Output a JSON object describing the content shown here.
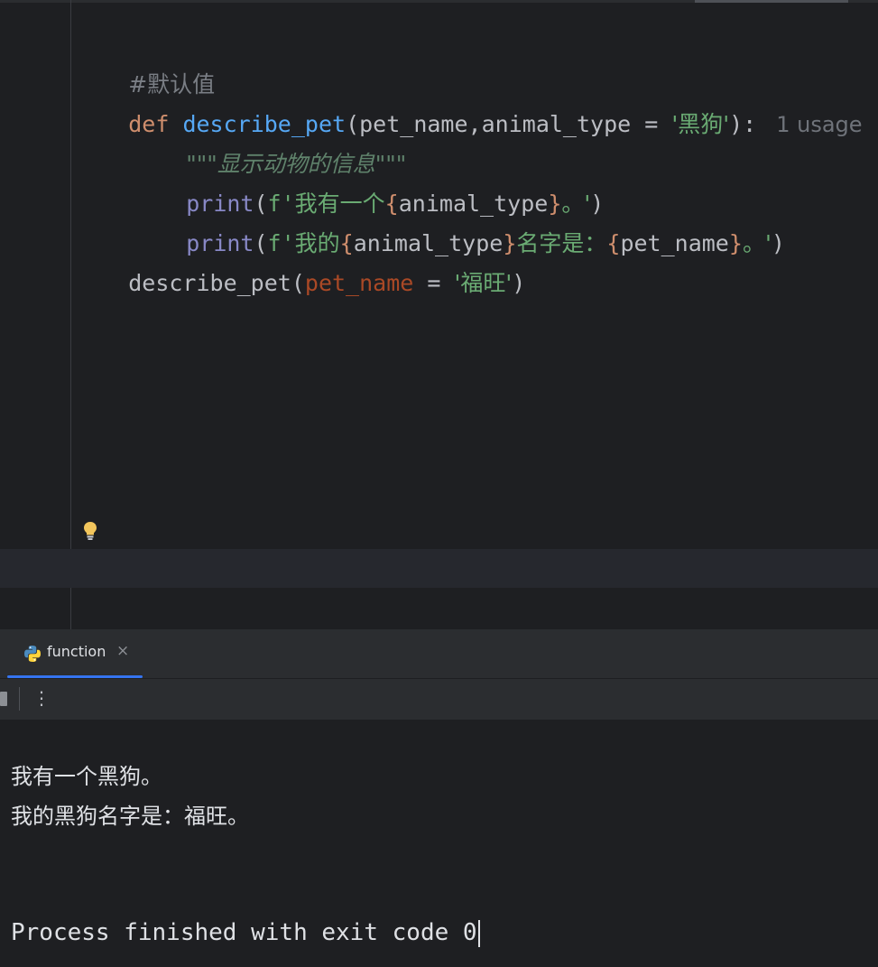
{
  "editor": {
    "comment": "#默认值",
    "def_keyword": "def",
    "func_name": "describe_pet",
    "open_paren": "(",
    "param1": "pet_name",
    "comma": ",",
    "param2": "animal_type",
    "assign": " = ",
    "default_value": "'黑狗'",
    "close_sig": "):",
    "usage_hint": "1 usage",
    "docstring": "\"\"\"显示动物的信息\"\"\"",
    "print1": {
      "func": "print",
      "open": "(",
      "fprefix": "f'",
      "text_before": "我有一个",
      "brace_open": "{",
      "var": "animal_type",
      "brace_close": "}",
      "text_after": "。'",
      "close": ")"
    },
    "print2": {
      "func": "print",
      "open": "(",
      "fprefix": "f'",
      "text_before": "我的",
      "brace_open1": "{",
      "var1": "animal_type",
      "brace_close1": "}",
      "text_mid": "名字是：",
      "brace_open2": "{",
      "var2": "pet_name",
      "brace_close2": "}",
      "text_after": "。'",
      "close": ")"
    },
    "call": {
      "func": "describe_pet",
      "open": "(",
      "arg_name": "pet_name",
      "assign": " = ",
      "arg_value": "'福旺'",
      "close": ")"
    }
  },
  "run_panel": {
    "tab_label": "function",
    "close_glyph": "×",
    "more_glyph": "⋮"
  },
  "console": {
    "output_lines": [
      "我有一个黑狗。",
      "我的黑狗名字是：福旺。"
    ],
    "exit_message": "Process finished with exit code 0"
  },
  "colors": {
    "background": "#1e1f22",
    "keyword": "#cf8e6d",
    "function": "#56a8f5",
    "string": "#6aab73",
    "builtin": "#8888c6",
    "accent": "#3574f0"
  }
}
